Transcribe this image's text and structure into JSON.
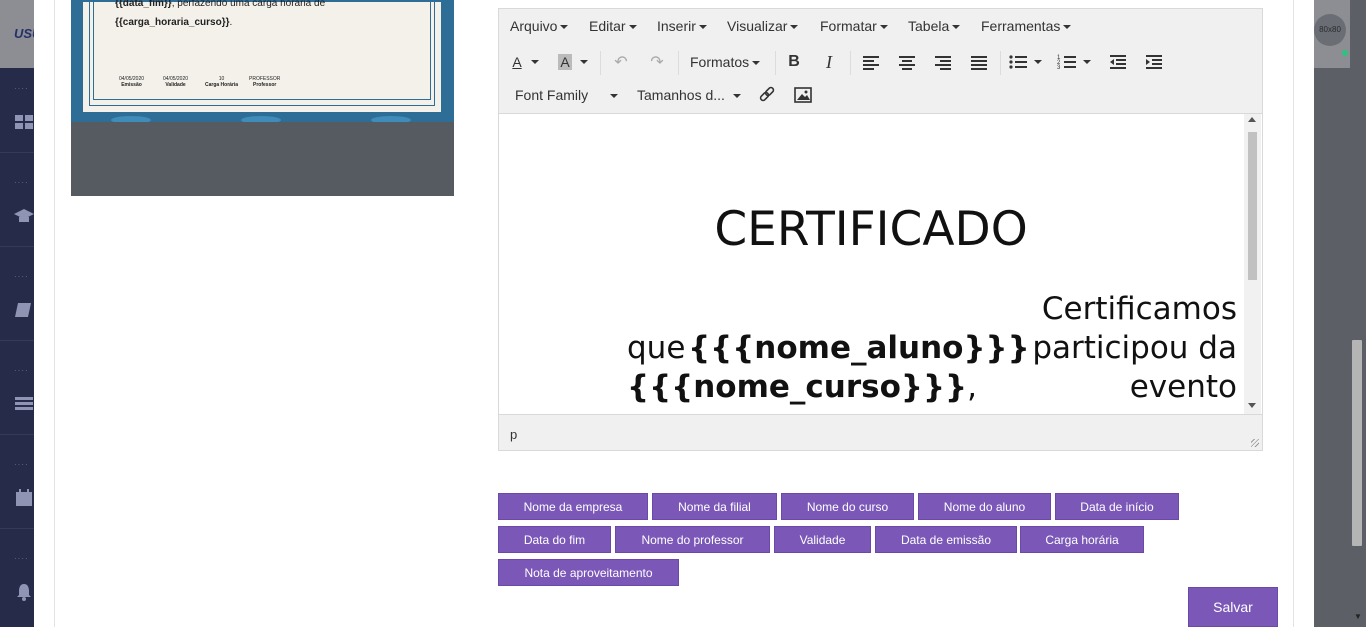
{
  "app": {
    "logo_text": "USU",
    "avatar_text": "80x80"
  },
  "preview": {
    "line1_var": "{{data_fim}}",
    "line1_rest": ", perfazendo uma carga horaria de",
    "line2_var": "{{carga_horaria_curso}}",
    "line2_rest": ".",
    "info": [
      {
        "value": "04/05/2020",
        "label": "Emissão"
      },
      {
        "value": "04/05/2020",
        "label": "Validade"
      },
      {
        "value": "10",
        "label": "Carga Horária"
      },
      {
        "value": "PROFESSOR",
        "label": "Professor"
      }
    ]
  },
  "editor": {
    "menu": [
      "Arquivo",
      "Editar",
      "Inserir",
      "Visualizar",
      "Formatar",
      "Tabela",
      "Ferramentas"
    ],
    "formats_label": "Formatos",
    "font_family_label": "Font Family",
    "font_sizes_label": "Tamanhos d...",
    "title": "CERTIFICADO",
    "body": {
      "w1": "Certificamos",
      "w2": "que",
      "v1": "{{{nome_aluno}}}",
      "w3": "participou da",
      "v2": "{{{nome_curso}}}",
      "w4": ",",
      "w5": "evento"
    },
    "status_path": "p"
  },
  "variables": {
    "row1": [
      "Nome da empresa",
      "Nome da filial",
      "Nome do curso",
      "Nome do aluno",
      "Data de início"
    ],
    "row2": [
      "Data do fim",
      "Nome do professor",
      "Validade",
      "Data de emissão",
      "Carga horária"
    ],
    "row3": [
      "Nota de aproveitamento"
    ]
  },
  "actions": {
    "save_label": "Salvar"
  },
  "colors": {
    "accent": "#7b58b8"
  }
}
